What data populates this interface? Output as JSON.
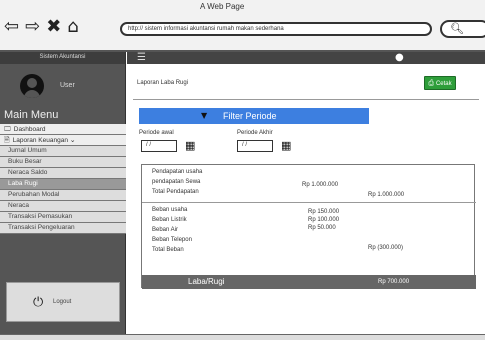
{
  "browser": {
    "title": "A Web Page",
    "url": "http://  sistem informasi akuntansi rumah makan sederhana",
    "nav_icons": [
      "back-icon",
      "forward-icon",
      "close-icon",
      "home-icon"
    ]
  },
  "sidebar": {
    "header": "Sistem Akuntansi",
    "user_label": "User",
    "main_menu": "Main Menu",
    "items": [
      {
        "label": "Dashboard",
        "icon": "monitor-icon",
        "type": "top"
      },
      {
        "label": "Laporan Keuangan",
        "icon": "document-icon",
        "type": "top"
      },
      {
        "label": "Jurnal Umum",
        "type": "sub"
      },
      {
        "label": "Buku Besar",
        "type": "sub"
      },
      {
        "label": "Neraca Saldo",
        "type": "sub"
      },
      {
        "label": "Laba Rugi",
        "type": "sub",
        "active": true
      },
      {
        "label": "Perubahan Modal",
        "type": "sub"
      },
      {
        "label": "Neraca",
        "type": "sub"
      },
      {
        "label": "Transaksi Pemasukan",
        "type": "sub"
      },
      {
        "label": "Transaksi Pengeluaran",
        "type": "sub"
      }
    ],
    "logout_label": "Logout"
  },
  "main": {
    "page_title": "Laporan Laba Rugi",
    "print_button": "Cetak",
    "filter_title": "Filter Periode",
    "period_start_label": "Periode awal",
    "period_end_label": "Periode Akhir",
    "date_placeholder": "/  /",
    "report": {
      "pendapatan_header": "Pendapatan usaha",
      "pendapatan_sewa_label": "pendapatan Sewa",
      "pendapatan_sewa_value": "Rp 1.000.000",
      "total_pendapatan_label": "Total Pendapatan",
      "total_pendapatan_value": "Rp 1.000.000",
      "beban_header": "Beban usaha",
      "beban_listrik_label": "Beban Listrik",
      "beban_listrik_value": "Rp 100.000",
      "beban_air_label": "Beban Air",
      "beban_air_value": "Rp 50.000",
      "beban_telepon_label": "Beban Telepon",
      "beban_usaha_value": "Rp 150.000",
      "total_beban_label": "Total Beban",
      "total_beban_value": "Rp (300.000)",
      "laba_rugi_label": "Laba/Rugi",
      "laba_rugi_value": "Rp 700.000"
    }
  },
  "colors": {
    "filter_bar": "#3d7fe0",
    "print_button": "#2e9e3a",
    "sidebar": "#555555"
  }
}
